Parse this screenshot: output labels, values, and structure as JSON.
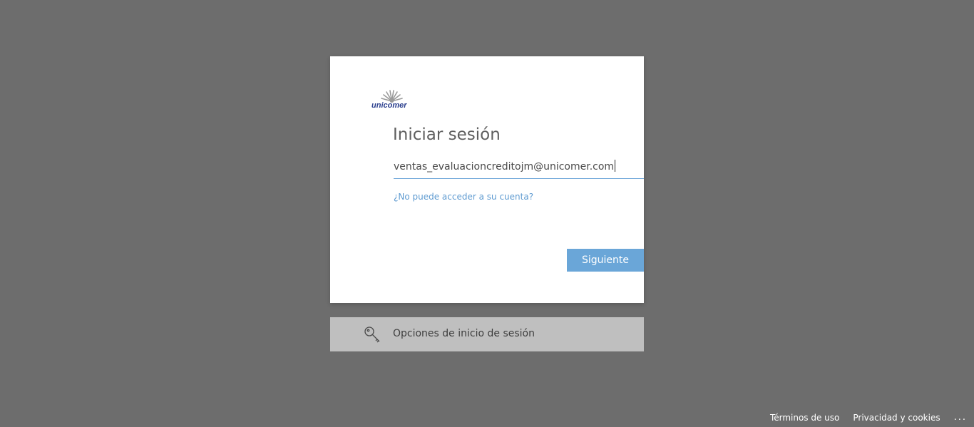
{
  "brand": {
    "logo_text": "unicomer",
    "logo_name": "unicomer-logo"
  },
  "signin": {
    "title": "Iniciar sesión",
    "email_value": "ventas_evaluacioncreditojm@unicomer.com",
    "cant_access_link": "¿No puede acceder a su cuenta?",
    "next_label": "Siguiente"
  },
  "options": {
    "label": "Opciones de inicio de sesión",
    "icon": "key-icon"
  },
  "footer": {
    "terms": "Términos de uso",
    "privacy": "Privacidad y cookies",
    "more": "..."
  },
  "colors": {
    "background": "#6d6d6d",
    "accent": "#6aa6d8",
    "link": "#5f9bd1",
    "options_bar": "#bfbfbf"
  }
}
